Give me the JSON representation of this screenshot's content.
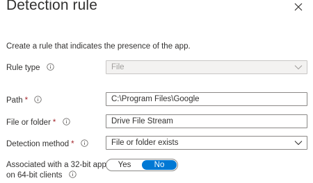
{
  "header": {
    "title": "Detection rule",
    "close_icon": "close-icon"
  },
  "description": "Create a rule that indicates the presence of the app.",
  "form": {
    "rule_type": {
      "label": "Rule type",
      "value": "File",
      "disabled": true
    },
    "path": {
      "label": "Path",
      "required_mark": "*",
      "value": "C:\\Program Files\\Google"
    },
    "file_or_folder": {
      "label": "File or folder",
      "required_mark": "*",
      "value": "Drive File Stream"
    },
    "detection_method": {
      "label": "Detection method",
      "required_mark": "*",
      "value": "File or folder exists"
    },
    "associated_32bit": {
      "label_line1": "Associated with a 32-bit app",
      "label_line2": "on 64-bit clients",
      "option_yes": "Yes",
      "option_no": "No",
      "selected": "No"
    }
  },
  "colors": {
    "accent": "#0078d4",
    "required": "#a4262c",
    "text": "#323130",
    "disabled_bg": "#f3f2f1"
  }
}
